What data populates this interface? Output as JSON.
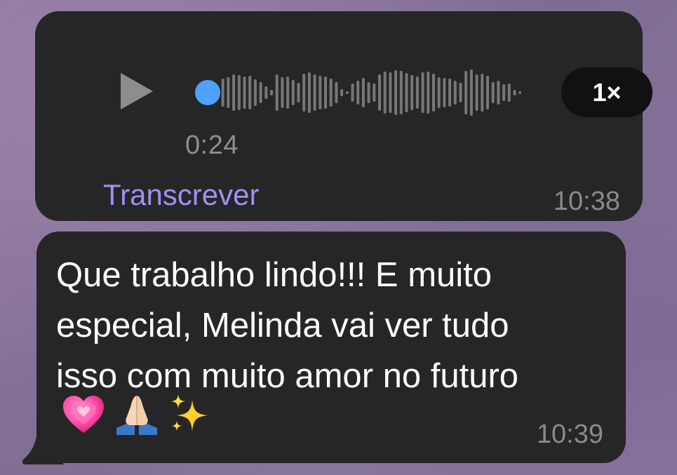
{
  "voice_message": {
    "duration": "0:24",
    "playback_speed": "1×",
    "progress": 0,
    "transcribe_label": "Transcrever",
    "timestamp": "10:38",
    "icons": {
      "play": "play-icon",
      "scrubber": "scrubber-dot-icon"
    }
  },
  "text_message": {
    "text": "Que trabalho lindo!!! E muito\nespecial, Melinda vai ver tudo\nisso com muito amor no futuro",
    "emojis": [
      "growing-heart-emoji",
      "folded-hands-emoji",
      "sparkles-emoji"
    ],
    "timestamp": "10:39"
  },
  "colors": {
    "bubble": "#262626",
    "accent": "#a48ef3",
    "scrubber": "#4da3ff",
    "meta_text": "#8a8a8a",
    "waveform": "#777777"
  }
}
